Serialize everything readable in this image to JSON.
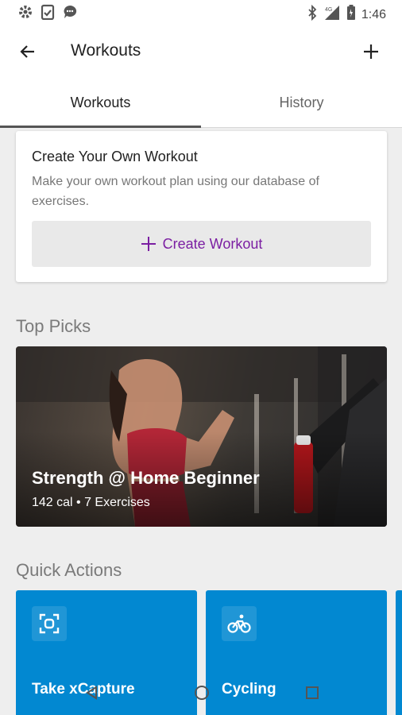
{
  "status_bar": {
    "time": "1:46",
    "left_icons": [
      "gear-icon",
      "clipboard-check-icon",
      "chat-bubble-icon"
    ],
    "right_icons": [
      "bluetooth-icon",
      "signal-4g-icon",
      "battery-icon"
    ]
  },
  "app_bar": {
    "title": "Workouts",
    "back_icon": "arrow-left-icon",
    "add_icon": "plus-icon"
  },
  "tabs": [
    {
      "label": "Workouts",
      "active": true
    },
    {
      "label": "History",
      "active": false
    }
  ],
  "create_card": {
    "title": "Create Your Own Workout",
    "description": "Make your own workout plan using our database of exercises.",
    "button_label": "Create Workout",
    "button_color": "#7b1fa2"
  },
  "top_picks": {
    "section_title": "Top Picks",
    "items": [
      {
        "title": "Strength @ Home Beginner",
        "subtitle": "142 cal • 7 Exercises"
      }
    ]
  },
  "quick_actions": {
    "section_title": "Quick Actions",
    "accent": "#0288d1",
    "items": [
      {
        "label": "Take xCapture",
        "icon": "scan-frame-icon"
      },
      {
        "label": "Cycling",
        "icon": "bike-icon"
      }
    ]
  },
  "system_nav": {
    "icons": [
      "back-triangle-icon",
      "home-circle-icon",
      "recents-square-icon"
    ]
  }
}
